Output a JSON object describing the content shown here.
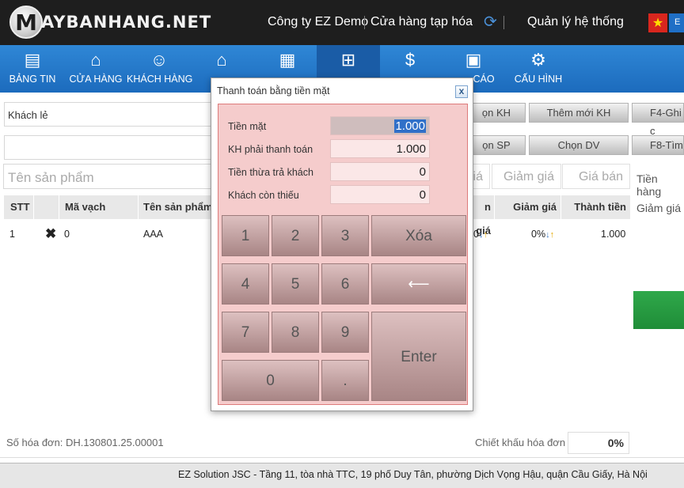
{
  "header": {
    "logo_letter": "M",
    "logo_text": "AYBANHANG.NET",
    "company": "Công ty EZ Demo",
    "store": "Cửa hàng tạp hóa",
    "admin": "Quản lý hệ thống",
    "lang": "E"
  },
  "nav": [
    {
      "label": "BẢNG TIN",
      "icon": "dashboard-icon"
    },
    {
      "label": "CỬA HÀNG",
      "icon": "store-icon"
    },
    {
      "label": "KHÁCH HÀNG",
      "icon": "customers-icon"
    },
    {
      "label": "",
      "icon": "home-icon"
    },
    {
      "label": "",
      "icon": "money-icon"
    },
    {
      "label": "",
      "icon": "cart-icon"
    },
    {
      "label": "",
      "icon": "dollar-doc-icon"
    },
    {
      "label": "CÁO",
      "icon": "report-icon"
    },
    {
      "label": "CẤU HÌNH",
      "icon": "settings-icon"
    }
  ],
  "left": {
    "customer": "Khách lẻ",
    "product_placeholder": "Tên sản phẩm",
    "price_placeholder": "giá",
    "discount_placeholder": "Giảm giá",
    "sale_price_placeholder": "Giá bán"
  },
  "buttons": {
    "cust_btn": "ọn KH",
    "add_cust": "Thêm mới KH",
    "f4": "F4-Ghi c",
    "prod_btn": "ọn SP",
    "choose_service": "Chọn DV",
    "f8": "F8-Tìm"
  },
  "table": {
    "headers": {
      "stt": "STT",
      "barcode": "Mã vạch",
      "name": "Tên sản phẩm",
      "price": "n giá",
      "discount": "Giảm giá",
      "total": "Thành tiền"
    },
    "rows": [
      {
        "stt": "1",
        "barcode": "0",
        "name": "AAA",
        "price": "0",
        "discount": "0%",
        "total": "1.000"
      }
    ]
  },
  "side": {
    "customer_money": "Tiền hàng",
    "discount": "Giảm giá"
  },
  "bottom": {
    "invoice": "Số hóa đơn: DH.130801.25.00001",
    "discount_label": "Chiết khấu hóa đơn",
    "discount_value": "0%"
  },
  "footer": "EZ Solution JSC - Tầng 11, tòa nhà TTC, 19 phố Duy Tân, phường Dịch Vọng Hậu, quận Cầu Giấy, Hà Nội",
  "modal": {
    "title": "Thanh toán bằng tiền mặt",
    "close": "x",
    "fields": [
      {
        "label": "Tiền mặt",
        "value": "1.000"
      },
      {
        "label": "KH phải thanh toán",
        "value": "1.000"
      },
      {
        "label": "Tiền thừa trả khách",
        "value": "0"
      },
      {
        "label": "Khách còn thiếu",
        "value": "0"
      }
    ],
    "keys": {
      "k1": "1",
      "k2": "2",
      "k3": "3",
      "clear": "Xóa",
      "k4": "4",
      "k5": "5",
      "k6": "6",
      "backspace": "⟵",
      "k7": "7",
      "k8": "8",
      "k9": "9",
      "enter": "Enter",
      "k0": "0",
      "dot": "."
    }
  },
  "colors": {
    "nav": "#2f87d6",
    "modal_bg": "#f5cccc",
    "accent_green": "#2fa84a"
  }
}
